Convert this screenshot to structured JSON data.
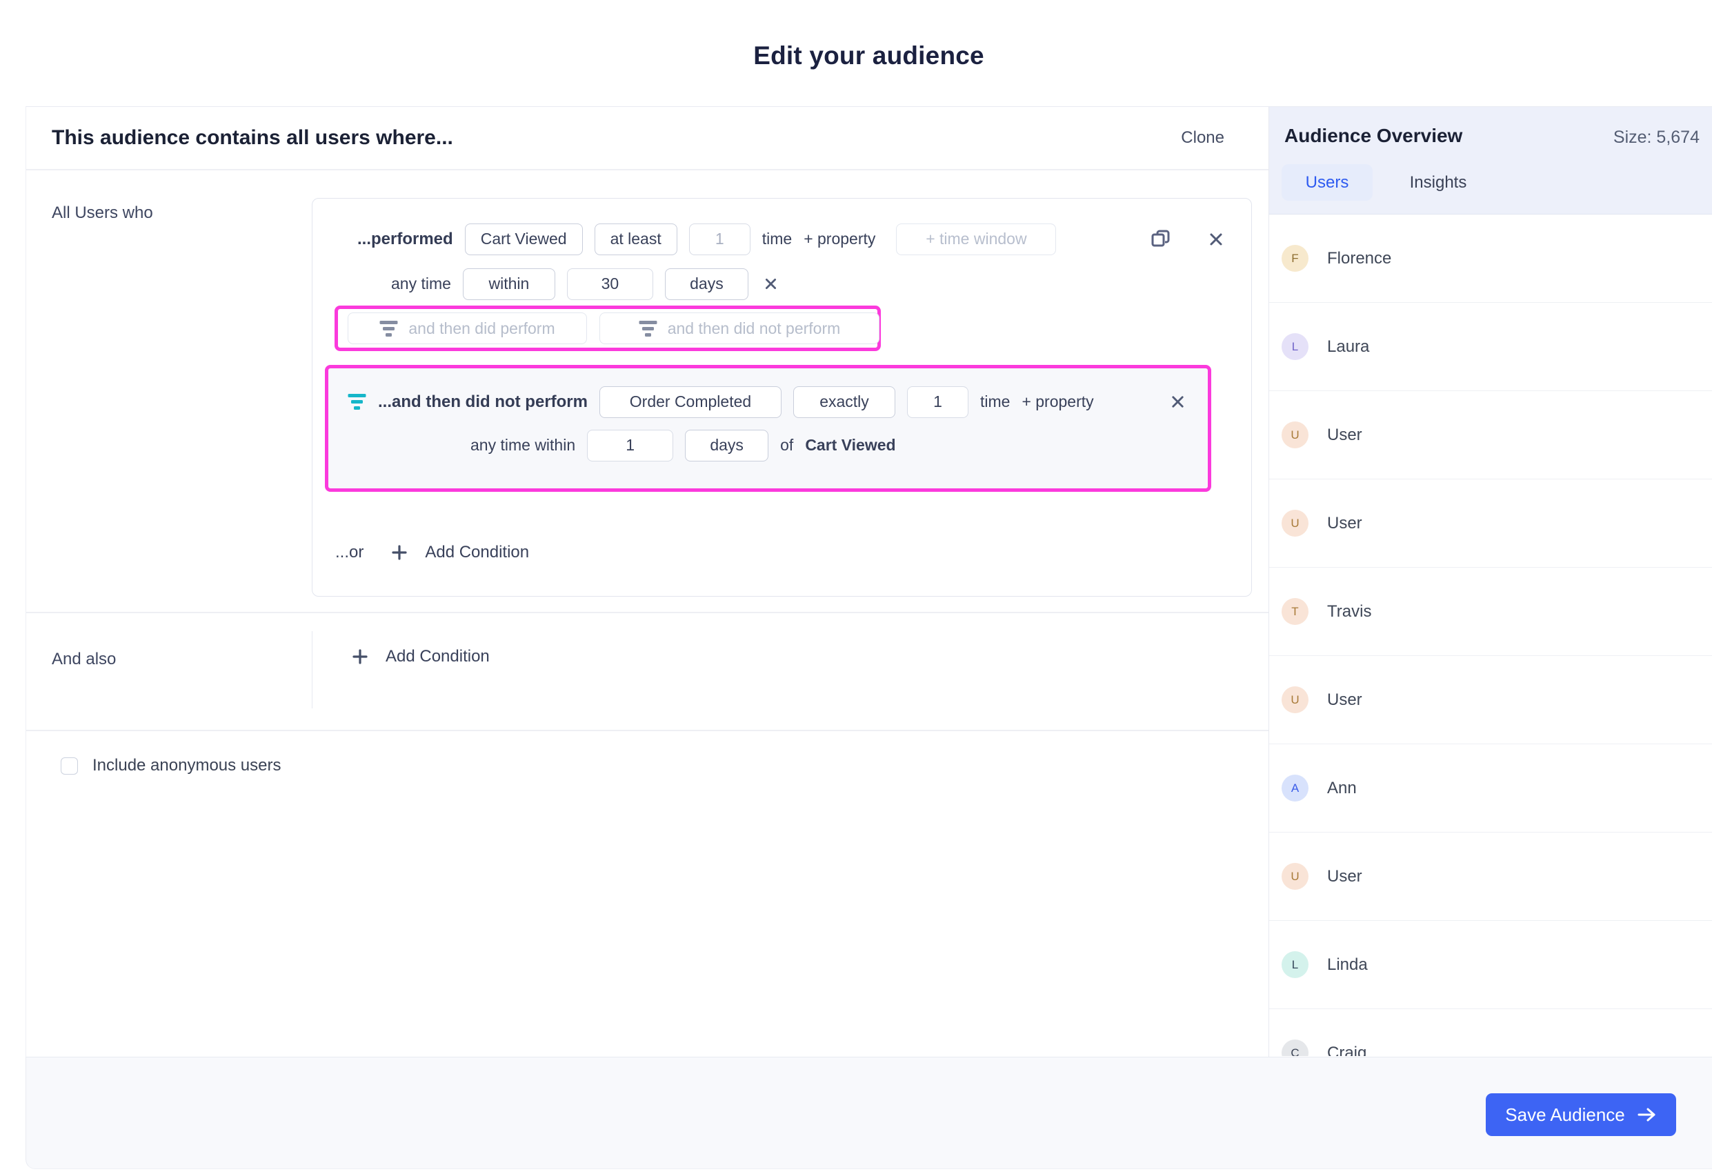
{
  "title": "Edit your audience",
  "builder": {
    "heading": "This audience contains all users where...",
    "clone_label": "Clone",
    "group1_label": "All Users who",
    "condition1": {
      "prefix": "...performed",
      "event": "Cart Viewed",
      "operator": "at least",
      "count": "1",
      "count_unit": "time",
      "add_property_label": "+ property",
      "time_window_placeholder": "+ time window",
      "timing_prefix": "any time",
      "timing_operator": "within",
      "timing_value": "30",
      "timing_unit": "days"
    },
    "sequence_buttons": {
      "did_perform_placeholder": "and then did perform",
      "did_not_perform_placeholder": "and then did not perform"
    },
    "condition2": {
      "prefix": "...and then did not perform",
      "event": "Order Completed",
      "operator": "exactly",
      "count": "1",
      "count_unit": "time",
      "add_property_label": "+ property",
      "timing_prefix": "any time within",
      "timing_value": "1",
      "timing_unit": "days",
      "timing_of": "of",
      "timing_reference": "Cart Viewed"
    },
    "or_label": "...or",
    "add_condition_label": "Add Condition",
    "group2_label": "And also",
    "anonymous_checkbox_label": "Include anonymous users"
  },
  "sidebar": {
    "title": "Audience Overview",
    "size_text": "Size: 5,674",
    "tabs": [
      {
        "label": "Users",
        "active": true
      },
      {
        "label": "Insights",
        "active": false
      }
    ],
    "users": [
      {
        "initial": "F",
        "name": "Florence",
        "theme": "amber"
      },
      {
        "initial": "L",
        "name": "Laura",
        "theme": "lavender"
      },
      {
        "initial": "U",
        "name": "User",
        "theme": "peach"
      },
      {
        "initial": "U",
        "name": "User",
        "theme": "peach"
      },
      {
        "initial": "T",
        "name": "Travis",
        "theme": "peach"
      },
      {
        "initial": "U",
        "name": "User",
        "theme": "peach"
      },
      {
        "initial": "A",
        "name": "Ann",
        "theme": "blue"
      },
      {
        "initial": "U",
        "name": "User",
        "theme": "peach"
      },
      {
        "initial": "L",
        "name": "Linda",
        "theme": "mint"
      },
      {
        "initial": "C",
        "name": "Craig",
        "theme": "gray"
      }
    ]
  },
  "footer": {
    "save_label": "Save Audience"
  },
  "colors": {
    "accent_blue": "#3d64f4",
    "highlight_magenta": "#fb3adc",
    "filter_teal": "#16b6c9",
    "sidebar_header_bg": "#edf0fa",
    "footer_bg": "#f8f9fc"
  }
}
